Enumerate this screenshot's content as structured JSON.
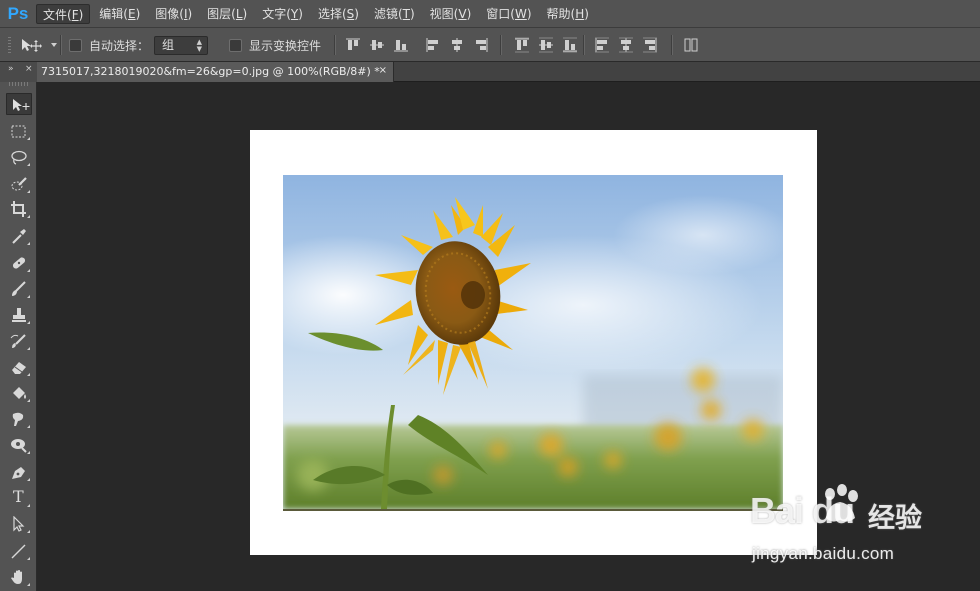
{
  "app": {
    "logo": "Ps"
  },
  "menu": [
    {
      "label": "文件(",
      "key": "F",
      "suffix": ")",
      "active": true
    },
    {
      "label": "编辑(",
      "key": "E",
      "suffix": ")"
    },
    {
      "label": "图像(",
      "key": "I",
      "suffix": ")"
    },
    {
      "label": "图层(",
      "key": "L",
      "suffix": ")"
    },
    {
      "label": "文字(",
      "key": "Y",
      "suffix": ")"
    },
    {
      "label": "选择(",
      "key": "S",
      "suffix": ")"
    },
    {
      "label": "滤镜(",
      "key": "T",
      "suffix": ")"
    },
    {
      "label": "视图(",
      "key": "V",
      "suffix": ")"
    },
    {
      "label": "窗口(",
      "key": "W",
      "suffix": ")"
    },
    {
      "label": "帮助(",
      "key": "H",
      "suffix": ")"
    }
  ],
  "options": {
    "auto_select_label": "自动选择：",
    "auto_select_value": "组",
    "show_transform_label": "显示变换控件"
  },
  "tabs": {
    "collapse_glyph": "»",
    "close_glyph": "×",
    "document_title": "7315017,3218019020&fm=26&gp=0.jpg @ 100%(RGB/8#) *",
    "document_close": "×"
  },
  "tools": [
    "move-tool",
    "marquee-tool",
    "lasso-tool",
    "quick-selection-tool",
    "crop-tool",
    "eyedropper-tool",
    "healing-brush-tool",
    "brush-tool",
    "clone-stamp-tool",
    "history-brush-tool",
    "eraser-tool",
    "paint-bucket-tool",
    "blur-tool",
    "dodge-tool",
    "pen-tool",
    "type-tool",
    "path-selection-tool",
    "line-tool",
    "hand-tool"
  ],
  "type_tool_glyph": "T",
  "watermark": {
    "brand": "Bai du",
    "cn": "经验",
    "url": "jingyan.baidu.com"
  },
  "colors": {
    "ui_bg": "#535353",
    "workspace_bg": "#282828",
    "ps_blue": "#31a8ff"
  }
}
